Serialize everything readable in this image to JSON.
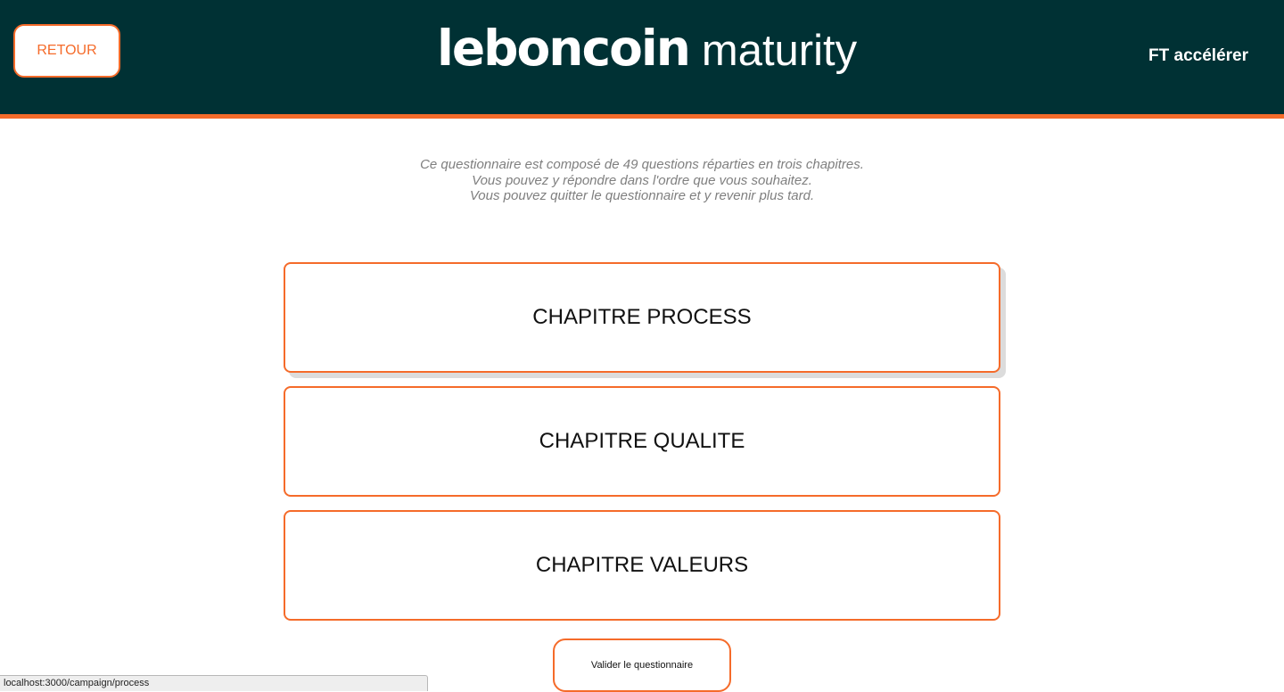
{
  "header": {
    "back_label": "RETOUR",
    "logo_brand": "leboncoin",
    "logo_product": "maturity",
    "team_name": "FT accélérer"
  },
  "intro": {
    "lines": [
      "Ce questionnaire est composé de 49 questions réparties en trois chapitres.",
      "Vous pouvez y répondre dans l'ordre que vous souhaitez.",
      "Vous pouvez quitter le questionnaire et y revenir plus tard."
    ]
  },
  "chapters": [
    {
      "label": "CHAPITRE PROCESS"
    },
    {
      "label": "CHAPITRE QUALITE"
    },
    {
      "label": "CHAPITRE VALEURS"
    }
  ],
  "validate_label": "Valider le questionnaire",
  "status_bar": {
    "url": "localhost:3000/campaign/process"
  },
  "colors": {
    "header_bg": "#003134",
    "accent": "#f56b2a",
    "intro_text": "#7f7f7f"
  }
}
